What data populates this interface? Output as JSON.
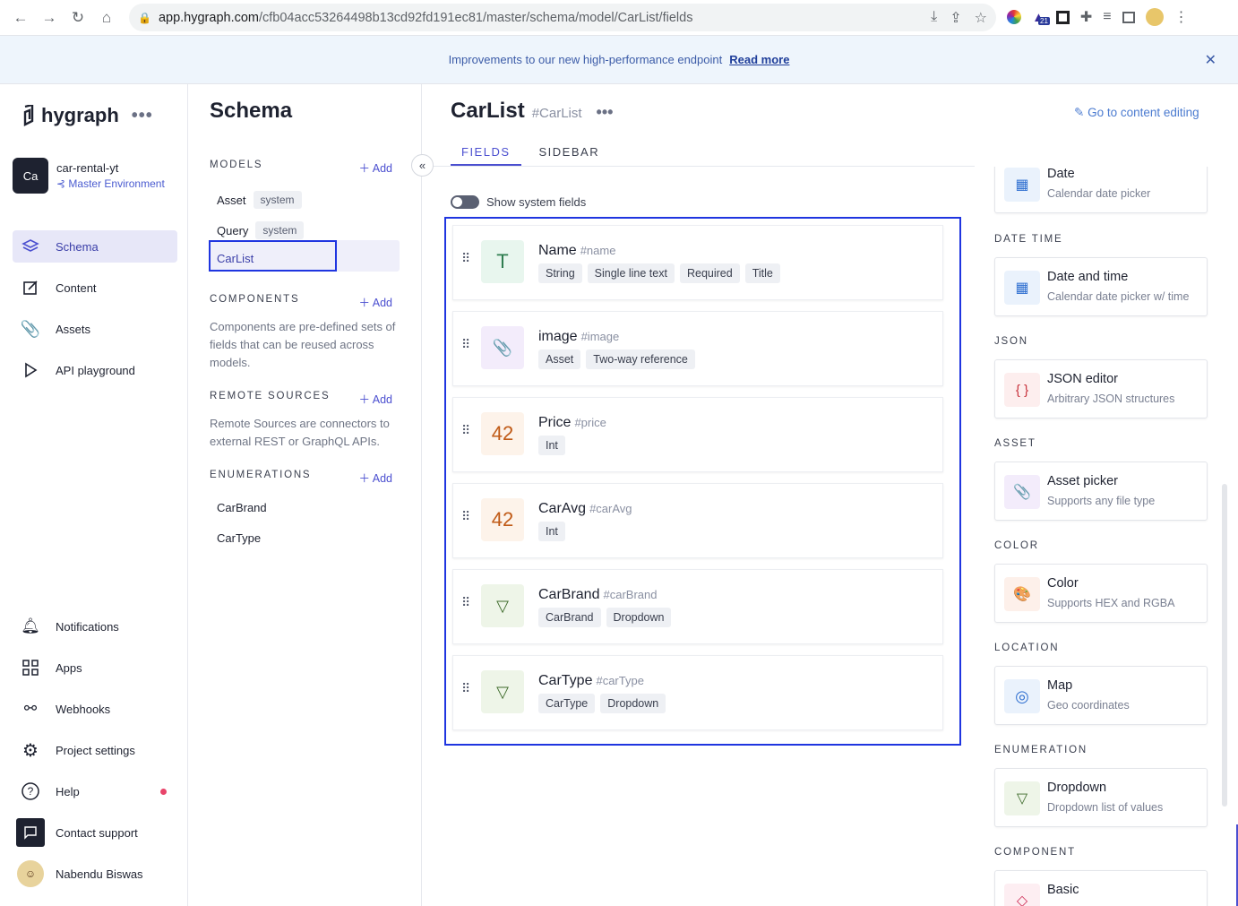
{
  "browser": {
    "url_host": "app.hygraph.com",
    "url_path": "/cfb04acc53264498b13cd92fd191ec81/master/schema/model/CarList/fields",
    "ext_badge": "21"
  },
  "banner": {
    "text": "Improvements to our new high-performance endpoint",
    "link": "Read more"
  },
  "brand": {
    "logo": "hygraph"
  },
  "project": {
    "avatar": "Ca",
    "name": "car-rental-yt",
    "environment": "Master Environment"
  },
  "nav": {
    "top": [
      {
        "label": "Schema",
        "icon": "layers-icon",
        "active": true
      },
      {
        "label": "Content",
        "icon": "edit-icon"
      },
      {
        "label": "Assets",
        "icon": "paperclip-icon"
      },
      {
        "label": "API playground",
        "icon": "play-icon"
      }
    ],
    "bottom": [
      {
        "label": "Notifications",
        "icon": "bell-icon"
      },
      {
        "label": "Apps",
        "icon": "grid-icon"
      },
      {
        "label": "Webhooks",
        "icon": "webhook-icon"
      },
      {
        "label": "Project settings",
        "icon": "gear-icon"
      },
      {
        "label": "Help",
        "icon": "help-icon"
      },
      {
        "label": "Contact support",
        "icon": "chat-icon"
      },
      {
        "label": "Nabendu Biswas",
        "icon": "user-avatar"
      }
    ]
  },
  "schema": {
    "title": "Schema",
    "add_label": "Add",
    "models_header": "MODELS",
    "models": [
      {
        "name": "Asset",
        "badge": "system"
      },
      {
        "name": "Query",
        "badge": "system"
      },
      {
        "name": "CarList",
        "badge": ""
      }
    ],
    "components_header": "COMPONENTS",
    "components_desc": "Components are pre-defined sets of fields that can be reused across models.",
    "remote_header": "REMOTE SOURCES",
    "remote_desc": "Remote Sources are connectors to external REST or GraphQL APIs.",
    "enum_header": "ENUMERATIONS",
    "enums": [
      "CarBrand",
      "CarType"
    ]
  },
  "model": {
    "title": "CarList",
    "api_id": "#CarList",
    "goto_label": "Go to content editing",
    "tabs": [
      "FIELDS",
      "SIDEBAR"
    ],
    "toggle_label": "Show system fields",
    "fields": [
      {
        "name": "Name",
        "api": "#name",
        "icon_text": "T",
        "icon_color": "#2e7d4f",
        "icon_bg": "#e8f6ee",
        "tags": [
          "String",
          "Single line text",
          "Required",
          "Title"
        ]
      },
      {
        "name": "image",
        "api": "#image",
        "icon_text": "📎",
        "icon_color": "#8b4fd0",
        "icon_bg": "#f3ecfb",
        "tags": [
          "Asset",
          "Two-way reference"
        ]
      },
      {
        "name": "Price",
        "api": "#price",
        "icon_text": "42",
        "icon_color": "#c05a16",
        "icon_bg": "#fdf3ea",
        "tags": [
          "Int"
        ]
      },
      {
        "name": "CarAvg",
        "api": "#carAvg",
        "icon_text": "42",
        "icon_color": "#c05a16",
        "icon_bg": "#fdf3ea",
        "tags": [
          "Int"
        ]
      },
      {
        "name": "CarBrand",
        "api": "#carBrand",
        "icon_text": "▽",
        "icon_color": "#3d6b2a",
        "icon_bg": "#eef5e8",
        "tags": [
          "CarBrand",
          "Dropdown"
        ]
      },
      {
        "name": "CarType",
        "api": "#carType",
        "icon_text": "▽",
        "icon_color": "#3d6b2a",
        "icon_bg": "#eef5e8",
        "tags": [
          "CarType",
          "Dropdown"
        ]
      }
    ]
  },
  "palette": {
    "date": [
      {
        "title": "Date",
        "desc": "Calendar date picker",
        "icon_text": "▦",
        "icon_color": "#2f6fd0",
        "icon_bg": "#eaf2fc"
      }
    ],
    "sections": [
      {
        "header": "DATE TIME",
        "cards": [
          {
            "title": "Date and time",
            "desc": "Calendar date picker w/ time",
            "icon_text": "▦",
            "icon_color": "#2f6fd0",
            "icon_bg": "#eaf2fc"
          }
        ]
      },
      {
        "header": "JSON",
        "cards": [
          {
            "title": "JSON editor",
            "desc": "Arbitrary JSON structures",
            "icon_text": "{ }",
            "icon_color": "#c8323c",
            "icon_bg": "#fdeeee"
          }
        ]
      },
      {
        "header": "ASSET",
        "cards": [
          {
            "title": "Asset picker",
            "desc": "Supports any file type",
            "icon_text": "📎",
            "icon_color": "#8b4fd0",
            "icon_bg": "#f3ecfb"
          }
        ]
      },
      {
        "header": "COLOR",
        "cards": [
          {
            "title": "Color",
            "desc": "Supports HEX and RGBA",
            "icon_text": "🎨",
            "icon_color": "#c05a16",
            "icon_bg": "#fdf0ea"
          }
        ]
      },
      {
        "header": "LOCATION",
        "cards": [
          {
            "title": "Map",
            "desc": "Geo coordinates",
            "icon_text": "◎",
            "icon_color": "#2f6fd0",
            "icon_bg": "#eaf2fc"
          }
        ]
      },
      {
        "header": "ENUMERATION",
        "cards": [
          {
            "title": "Dropdown",
            "desc": "Dropdown list of values",
            "icon_text": "▽",
            "icon_color": "#3d6b2a",
            "icon_bg": "#eef5e8"
          }
        ]
      },
      {
        "header": "COMPONENT",
        "cards": [
          {
            "title": "Basic",
            "desc": "",
            "icon_text": "◇",
            "icon_color": "#d0325a",
            "icon_bg": "#fdeef2"
          }
        ]
      }
    ]
  }
}
